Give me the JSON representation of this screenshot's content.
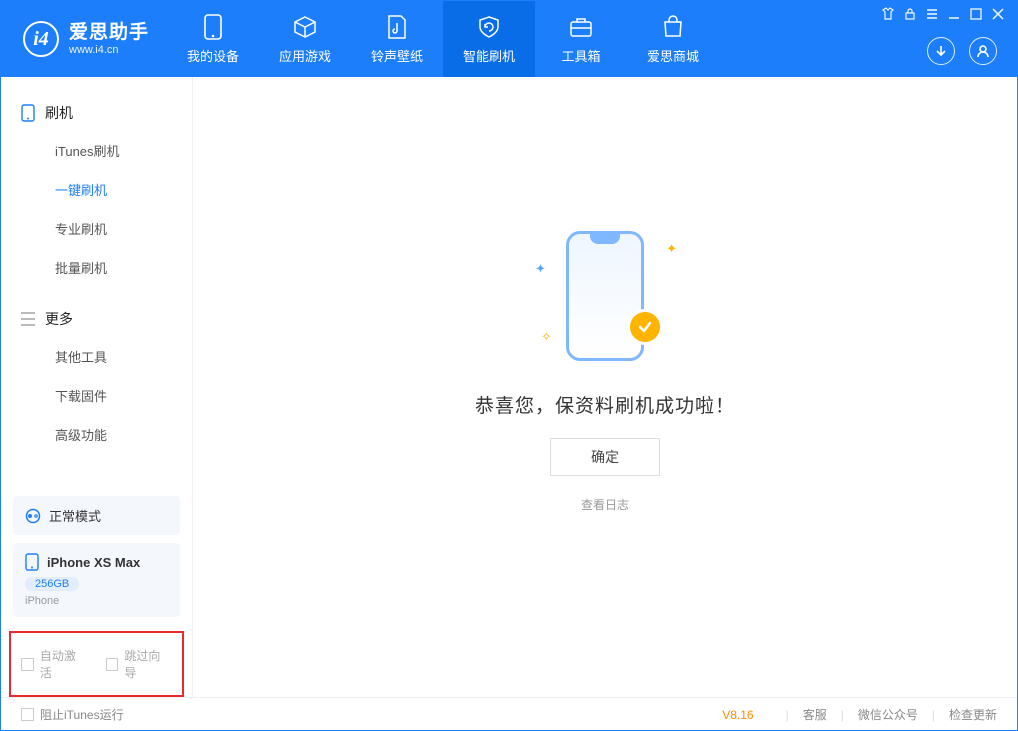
{
  "app": {
    "name_cn": "爱思助手",
    "name_en": "www.i4.cn"
  },
  "nav": {
    "items": [
      {
        "label": "我的设备"
      },
      {
        "label": "应用游戏"
      },
      {
        "label": "铃声壁纸"
      },
      {
        "label": "智能刷机"
      },
      {
        "label": "工具箱"
      },
      {
        "label": "爱思商城"
      }
    ]
  },
  "sidebar": {
    "section1_title": "刷机",
    "items1": [
      {
        "label": "iTunes刷机"
      },
      {
        "label": "一键刷机"
      },
      {
        "label": "专业刷机"
      },
      {
        "label": "批量刷机"
      }
    ],
    "section2_title": "更多",
    "items2": [
      {
        "label": "其他工具"
      },
      {
        "label": "下载固件"
      },
      {
        "label": "高级功能"
      }
    ]
  },
  "device": {
    "mode_label": "正常模式",
    "name": "iPhone XS Max",
    "storage": "256GB",
    "type": "iPhone"
  },
  "options": {
    "auto_activate": "自动激活",
    "skip_guide": "跳过向导"
  },
  "main": {
    "success_msg": "恭喜您，保资料刷机成功啦！",
    "ok_btn": "确定",
    "view_log": "查看日志"
  },
  "footer": {
    "block_itunes": "阻止iTunes运行",
    "version": "V8.16",
    "links": [
      "客服",
      "微信公众号",
      "检查更新"
    ]
  }
}
